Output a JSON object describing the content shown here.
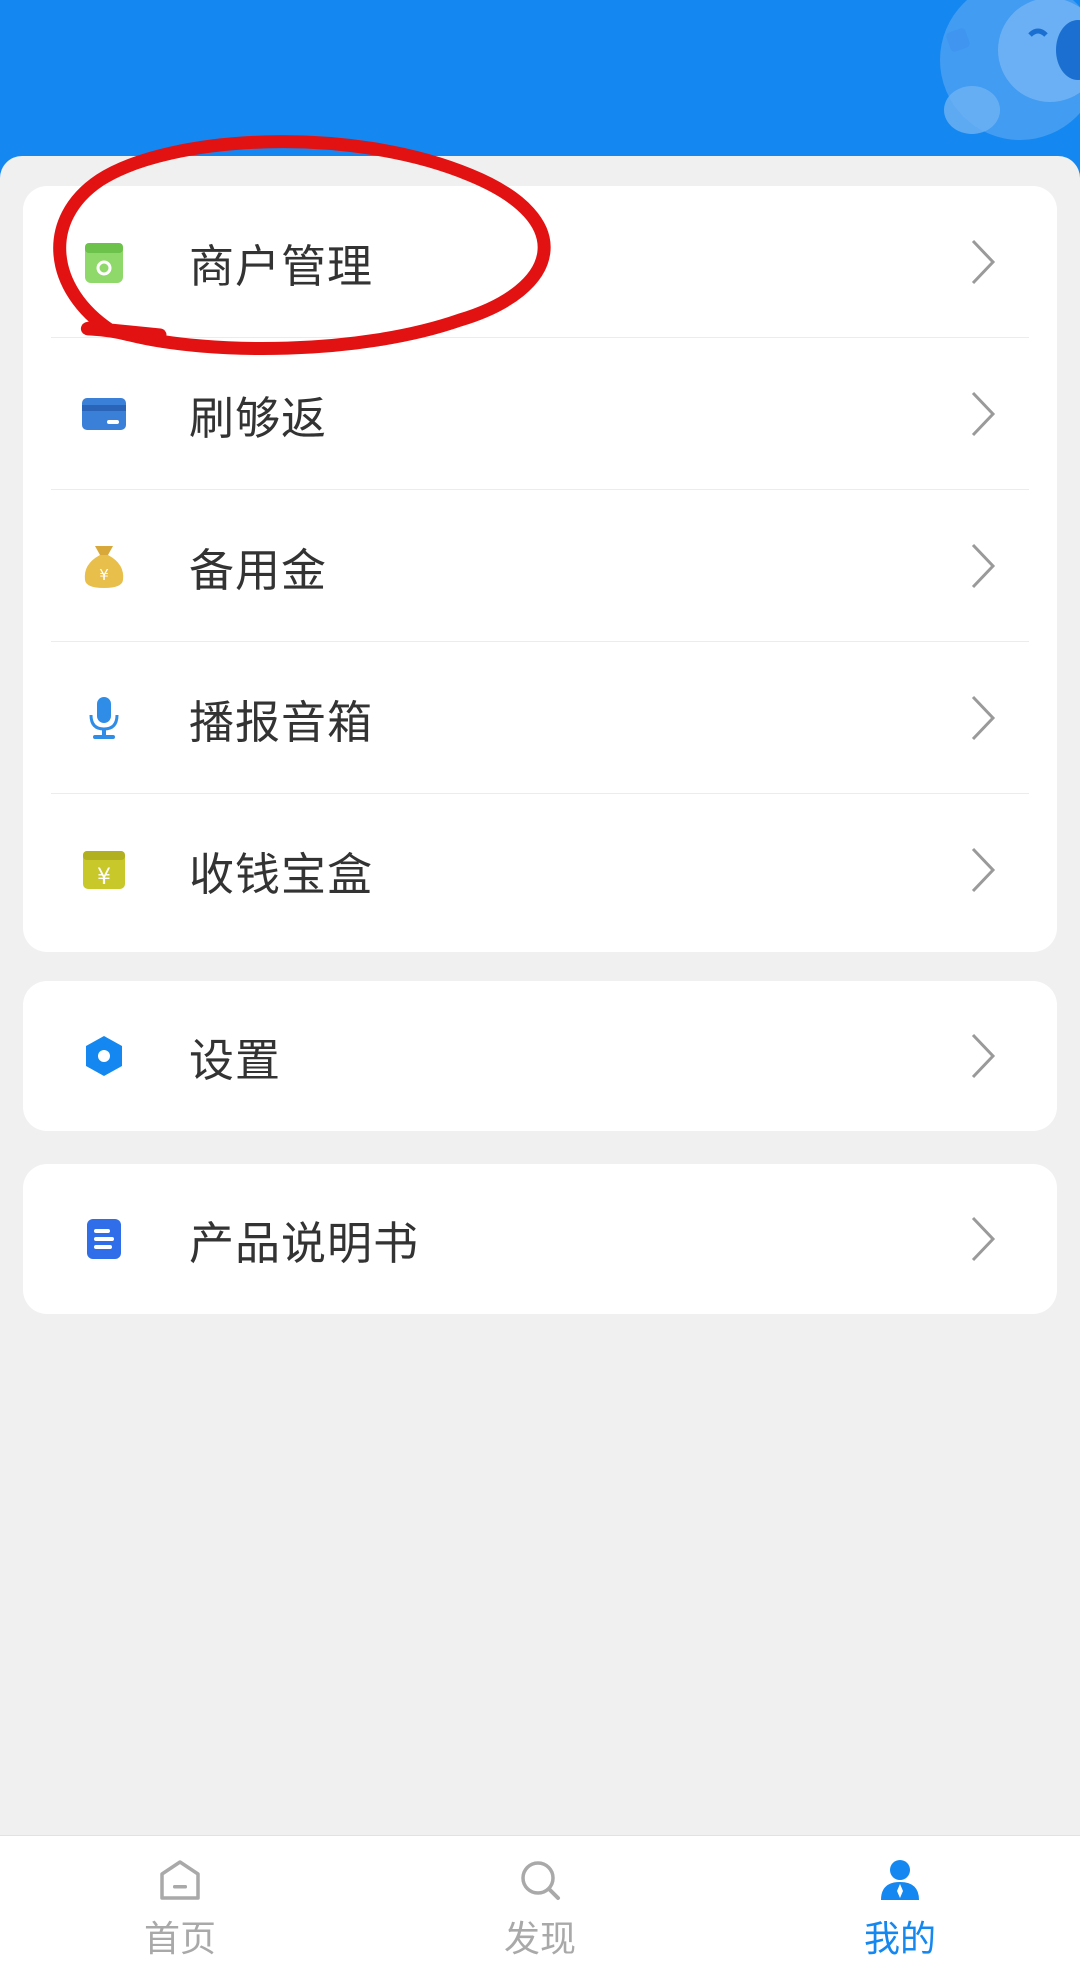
{
  "colors": {
    "header_blue": "#1488f0",
    "active_tab": "#1488f0",
    "inactive_tab": "#a9a9a9",
    "annotation_red": "#e21212"
  },
  "menu_group_1": [
    {
      "label": "商户管理",
      "icon": "store-icon"
    },
    {
      "label": "刷够返",
      "icon": "card-icon"
    },
    {
      "label": "备用金",
      "icon": "money-bag-icon"
    },
    {
      "label": "播报音箱",
      "icon": "microphone-icon"
    },
    {
      "label": "收钱宝盒",
      "icon": "cash-box-icon"
    }
  ],
  "menu_group_2": [
    {
      "label": "设置",
      "icon": "settings-icon"
    }
  ],
  "menu_group_3": [
    {
      "label": "产品说明书",
      "icon": "document-icon"
    }
  ],
  "tabbar": {
    "items": [
      {
        "label": "首页",
        "icon": "home-icon",
        "active": false
      },
      {
        "label": "发现",
        "icon": "search-icon",
        "active": false
      },
      {
        "label": "我的",
        "icon": "profile-icon",
        "active": true
      }
    ]
  }
}
